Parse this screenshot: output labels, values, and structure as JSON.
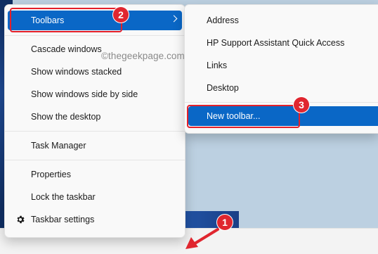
{
  "main_menu": {
    "items": [
      {
        "label": "Toolbars",
        "selected": true,
        "has_submenu": true
      },
      {
        "label": "Cascade windows"
      },
      {
        "label": "Show windows stacked"
      },
      {
        "label": "Show windows side by side"
      },
      {
        "label": "Show the desktop"
      },
      {
        "label": "Task Manager"
      },
      {
        "label": "Properties"
      },
      {
        "label": "Lock the taskbar"
      },
      {
        "label": "Taskbar settings",
        "icon": "gear-icon"
      }
    ]
  },
  "sub_menu": {
    "items": [
      {
        "label": "Address"
      },
      {
        "label": "HP Support Assistant Quick Access"
      },
      {
        "label": "Links"
      },
      {
        "label": "Desktop"
      },
      {
        "label": "New toolbar...",
        "selected": true
      }
    ]
  },
  "watermark": "©thegeekpage.com",
  "annotations": {
    "step1": "1",
    "step2": "2",
    "step3": "3"
  },
  "colors": {
    "accent": "#0a67c6",
    "annotation_red": "#e0262f",
    "menu_background": "#f9f9f9"
  }
}
